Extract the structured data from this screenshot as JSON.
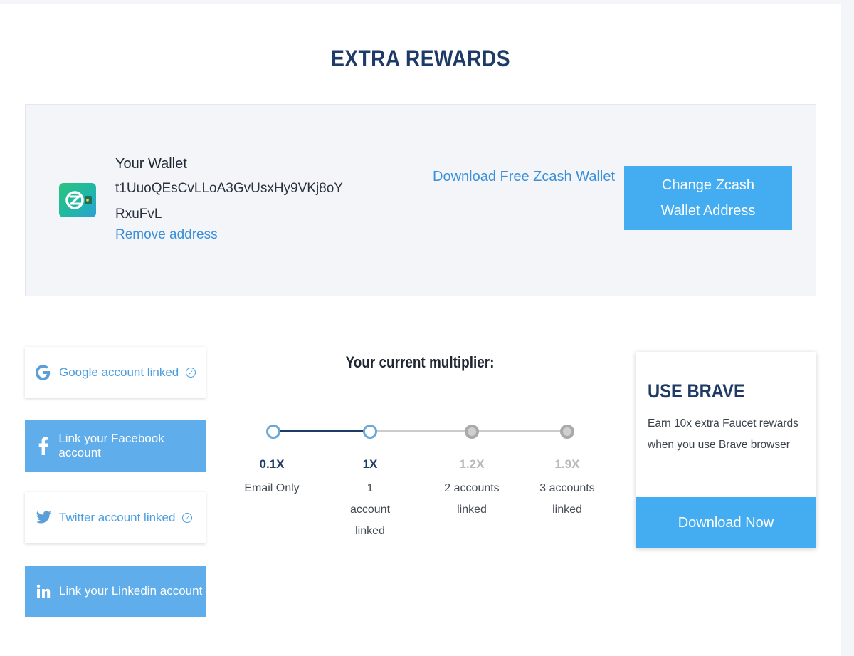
{
  "page": {
    "title": "EXTRA REWARDS"
  },
  "wallet": {
    "label": "Your Wallet",
    "address": "t1UuoQEsCvLLoA3GvUsxHy9VKj8oYRxuFvL",
    "remove_label": "Remove address",
    "download_label": "Download Free Zcash Wallet",
    "change_label": "Change Zcash Wallet Address",
    "icon": "zcash-wallet-icon"
  },
  "social": [
    {
      "label": "Google account linked",
      "icon": "google-icon",
      "linked": true
    },
    {
      "label": "Link your Facebook account",
      "icon": "facebook-icon",
      "linked": false
    },
    {
      "label": "Twitter account linked",
      "icon": "twitter-icon",
      "linked": true
    },
    {
      "label": "Link your Linkedin account",
      "icon": "linkedin-icon",
      "linked": false
    }
  ],
  "multiplier": {
    "title": "Your current multiplier:",
    "steps": [
      {
        "value": "0.1X",
        "label": "Email Only",
        "active": true
      },
      {
        "value": "1X",
        "label": "1 account linked",
        "active": true
      },
      {
        "value": "1.2X",
        "label": "2 accounts linked",
        "active": false
      },
      {
        "value": "1.9X",
        "label": "3 accounts linked",
        "active": false
      }
    ]
  },
  "brave": {
    "title": "USE BRAVE",
    "description": "Earn 10x extra Faucet rewards when you use Brave browser",
    "button_label": "Download Now"
  },
  "colors": {
    "primary_blue": "#44acf0",
    "link_blue": "#3a8fd9",
    "heading_navy": "#1e3a66",
    "track_active": "#1e3a66",
    "track_inactive": "#cccccc"
  }
}
